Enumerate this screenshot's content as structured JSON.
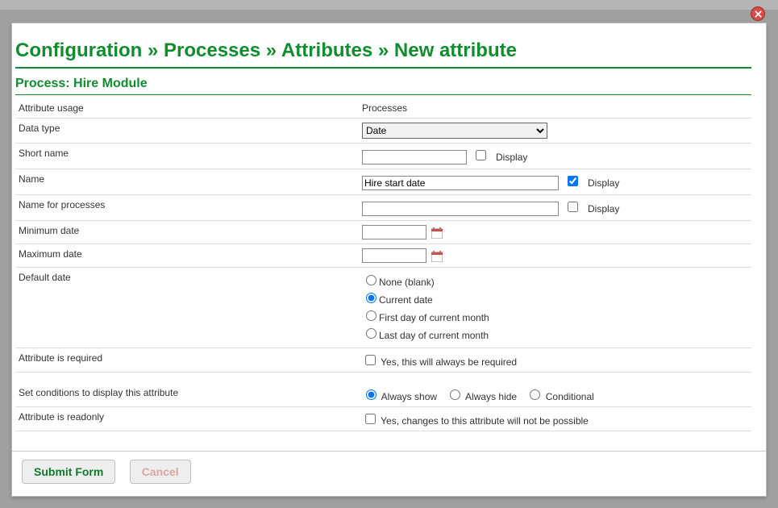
{
  "breadcrumb": {
    "parts": [
      "Configuration",
      "Processes",
      "Attributes",
      "New attribute"
    ],
    "sep": " » "
  },
  "process_title": "Process: Hire Module",
  "labels": {
    "attribute_usage": "Attribute usage",
    "data_type": "Data type",
    "short_name": "Short name",
    "name": "Name",
    "name_for_processes": "Name for processes",
    "minimum_date": "Minimum date",
    "maximum_date": "Maximum date",
    "default_date": "Default date",
    "attribute_required": "Attribute is required",
    "display_conditions": "Set conditions to display this attribute",
    "attribute_readonly": "Attribute is readonly",
    "display": "Display"
  },
  "values": {
    "attribute_usage": "Processes",
    "data_type_options": [
      "Date"
    ],
    "data_type_selected": "Date",
    "short_name": "",
    "short_name_display": false,
    "name": "Hire start date",
    "name_display": true,
    "name_for_processes": "",
    "name_for_processes_display": false,
    "minimum_date": "",
    "maximum_date": "",
    "default_date_options": {
      "none": "None (blank)",
      "current": "Current date",
      "first": "First day of current month",
      "last": "Last day of current month"
    },
    "default_date_selected": "current",
    "required_label": "Yes, this will always be required",
    "required_checked": false,
    "display_cond_options": {
      "always_show": "Always show",
      "always_hide": "Always hide",
      "conditional": "Conditional"
    },
    "display_cond_selected": "always_show",
    "readonly_label": "Yes, changes to this attribute will not be possible",
    "readonly_checked": false
  },
  "buttons": {
    "submit": "Submit Form",
    "cancel": "Cancel"
  }
}
